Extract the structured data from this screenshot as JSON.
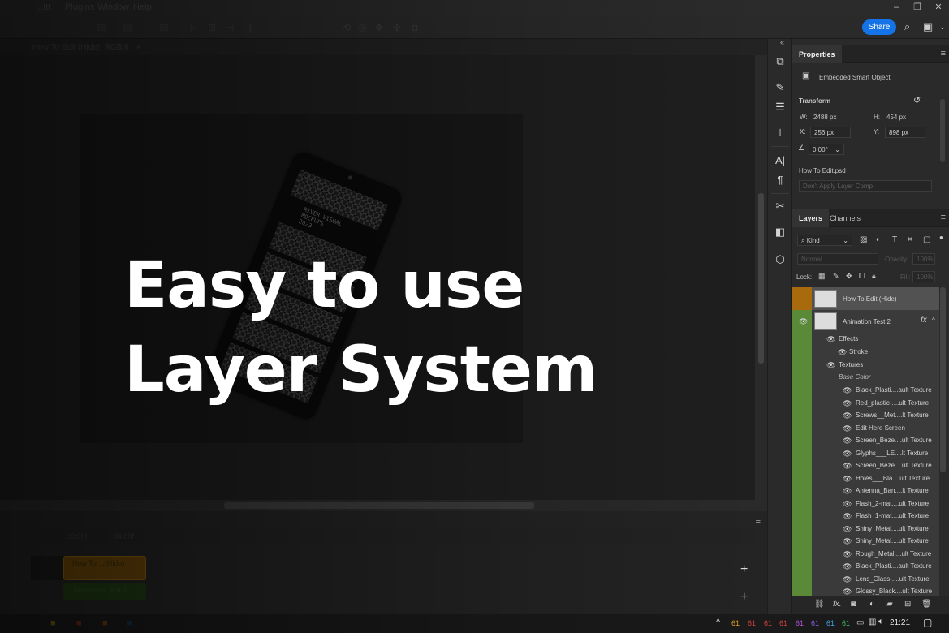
{
  "menu": {
    "items": [
      "...Itt",
      "Plugins",
      "Window",
      "Help"
    ]
  },
  "window_controls": [
    "–",
    "❐",
    "✕"
  ],
  "options_bar": {
    "share_label": "Share"
  },
  "document": {
    "tab_title": "How To Edit (Hide), RGB/8",
    "close": "×"
  },
  "phone_screen": {
    "caption": "RIVER VISUAL\nMOCKUPS\n2023"
  },
  "overlay": {
    "line1": "Easy to use",
    "line2": "Layer System"
  },
  "timeline": {
    "time_marks": [
      "00:00f",
      "04:00f"
    ],
    "tracks": [
      {
        "label": "How To ...(Hide)"
      },
      {
        "label": "Animation Test 2"
      }
    ]
  },
  "properties": {
    "tab": "Properties",
    "object_type": "Embedded Smart Object",
    "transform_title": "Transform",
    "w_label": "W:",
    "w_value": "2488 px",
    "h_label": "H:",
    "h_value": "454 px",
    "x_label": "X:",
    "x_value": "256 px",
    "y_label": "Y:",
    "y_value": "898 px",
    "angle_value": "0,00°",
    "file_name": "How To Edit.psd",
    "layer_comp": "Don't Apply Layer Comp"
  },
  "layers": {
    "tabs": [
      "Layers",
      "Channels"
    ],
    "filter_kind": "Kind",
    "blend_mode": "Normal",
    "opacity_label": "Opacity:",
    "opacity_value": "100%",
    "lock_label": "Lock:",
    "fill_label": "Fill:",
    "fill_value": "100%",
    "top_layers": [
      {
        "name": "How To Edit (Hide)",
        "color": "#a86a0c"
      },
      {
        "name": "Animation Test 2",
        "color": "#5a8a38"
      }
    ],
    "fx_label": "fx",
    "effects_label": "Effects",
    "stroke_label": "Stroke",
    "textures_label": "Textures",
    "base_color_label": "Base Color",
    "sub_layers": [
      "Black_Plasti....ault Texture",
      "Red_plastic-....ult Texture",
      "Screws__Met....lt Texture",
      "Edit Here Screen",
      "Screen_Beze....ult Texture",
      "Glyphs___LE....lt Texture",
      "Screen_Beze....ult Texture",
      "Holes___Bla....ult Texture",
      "Antenna_Ban....lt Texture",
      "Flash_2-mat....ult Texture",
      "Flash_1-mat....ult Texture",
      "Shiny_Metal....ult Texture",
      "Shiny_Metal....ult Texture",
      "Rough_Metal....ult Texture",
      "Black_Plasti....ault Texture",
      "Lens_Glass-....ult Texture",
      "Glossy_Black....ult Texture"
    ]
  },
  "taskbar": {
    "tray_numbers": [
      {
        "v": "61",
        "c": "#e0a020"
      },
      {
        "v": "61",
        "c": "#d04040"
      },
      {
        "v": "61",
        "c": "#d04040"
      },
      {
        "v": "61",
        "c": "#d04040"
      },
      {
        "v": "61",
        "c": "#b050d0"
      },
      {
        "v": "61",
        "c": "#8060e0"
      },
      {
        "v": "61",
        "c": "#40a0e0"
      },
      {
        "v": "61",
        "c": "#40c060"
      }
    ],
    "clock": "21:21"
  },
  "colors": {
    "share_blue": "#1473e6",
    "orange_layer": "#a86a0c",
    "green_layer": "#5a8a38"
  }
}
